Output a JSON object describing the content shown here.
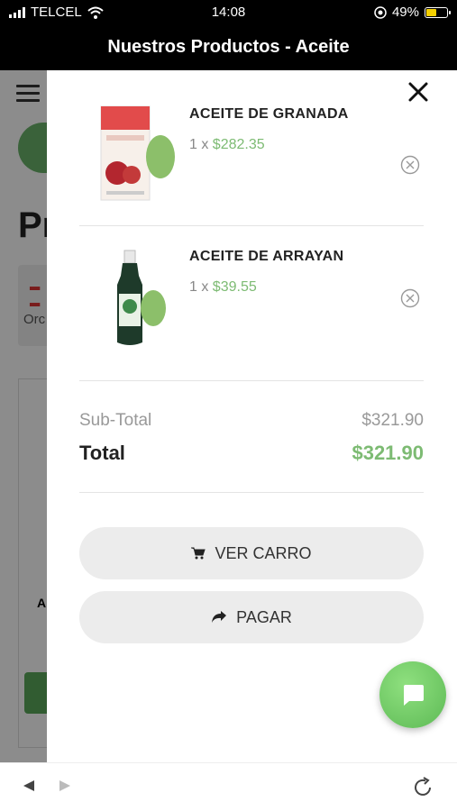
{
  "status": {
    "carrier": "TELCEL",
    "time": "14:08",
    "battery": "49%",
    "battery_color": "#f5d000"
  },
  "header": {
    "title": "Nuestros Productos - Aceite"
  },
  "background_page": {
    "title_partial": "Pr",
    "sort_label_partial": "Orc",
    "card_text_partial": "A"
  },
  "cart": {
    "items": [
      {
        "name": "ACEITE DE GRANADA",
        "qty_prefix": "1 x ",
        "price": "$282.35"
      },
      {
        "name": "ACEITE DE ARRAYAN",
        "qty_prefix": "1 x ",
        "price": "$39.55"
      }
    ],
    "subtotal_label": "Sub-Total",
    "subtotal_value": "$321.90",
    "total_label": "Total",
    "total_value": "$321.90",
    "view_cart_label": "VER CARRO",
    "checkout_label": "PAGAR"
  },
  "colors": {
    "accent_green": "#7dbb73",
    "chat_green": "#5dba55"
  },
  "icons": [
    "close-icon",
    "remove-icon",
    "cart-icon",
    "share-arrow-icon",
    "chat-icon",
    "back-arrow-icon",
    "forward-arrow-icon",
    "reload-icon",
    "wifi-icon",
    "signal-icon",
    "battery-icon",
    "location-icon"
  ]
}
